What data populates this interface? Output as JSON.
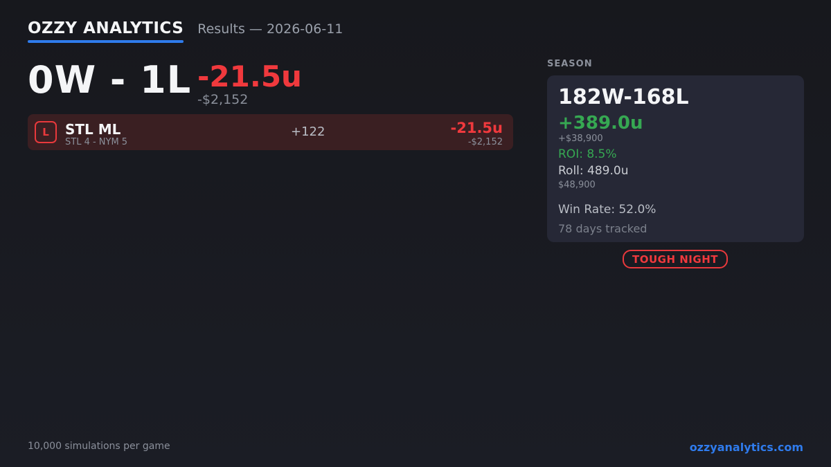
{
  "header": {
    "brand": "OZZY ANALYTICS",
    "subtitle": "Results — 2026-06-11"
  },
  "day": {
    "record": "0W - 1L",
    "units": "-21.5u",
    "dollars": "-$2,152"
  },
  "bets": [
    {
      "result": "L",
      "name": "STL ML",
      "score": "STL 4 - NYM 5",
      "odds": "+122",
      "units": "-21.5u",
      "dollars": "-$2,152"
    }
  ],
  "season": {
    "label": "SEASON",
    "record": "182W-168L",
    "units": "+389.0u",
    "dollars": "+$38,900",
    "roi": "ROI: 8.5%",
    "roll": "Roll: 489.0u",
    "roll_dollars": "$48,900",
    "win_rate": "Win Rate: 52.0%",
    "days_tracked": "78 days tracked"
  },
  "badge": "TOUGH NIGHT",
  "footer": {
    "left": "10,000 simulations per game",
    "right": "ozzyanalytics.com"
  },
  "colors": {
    "loss": "#f0393d",
    "win": "#36a852",
    "accent": "#2f7bec",
    "loss_row_bg": "#3a1f22",
    "card_bg": "#262836"
  }
}
